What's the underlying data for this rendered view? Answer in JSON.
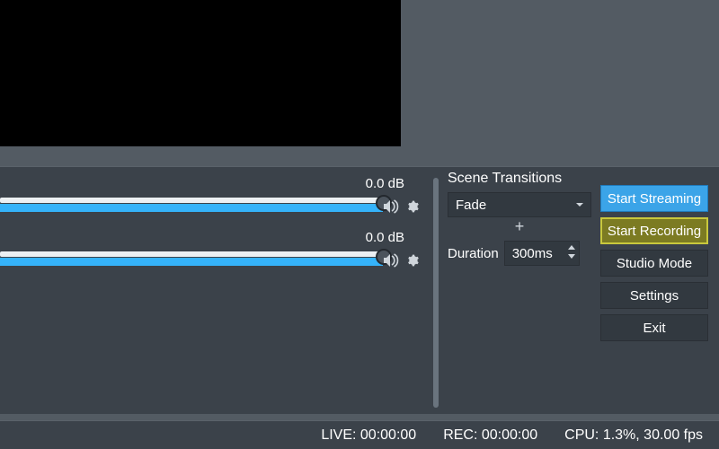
{
  "mixer": {
    "channels": [
      {
        "db_label": "0.0 dB",
        "fill_percent": 100
      },
      {
        "db_label": "0.0 dB",
        "fill_percent": 100
      }
    ]
  },
  "transitions": {
    "title": "Scene Transitions",
    "selected": "Fade",
    "duration_label": "Duration",
    "duration_value": "300ms"
  },
  "controls": {
    "start_streaming": "Start Streaming",
    "start_recording": "Start Recording",
    "studio_mode": "Studio Mode",
    "settings": "Settings",
    "exit": "Exit"
  },
  "status": {
    "live": "LIVE: 00:00:00",
    "rec": "REC: 00:00:00",
    "cpu": "CPU: 1.3%, 30.00 fps"
  },
  "icons": {
    "speaker": "speaker-icon",
    "gear": "gear-icon",
    "chevron_down": "chevron-down-icon",
    "plus": "+",
    "stepper_up": "stepper-up-icon",
    "stepper_down": "stepper-down-icon"
  }
}
